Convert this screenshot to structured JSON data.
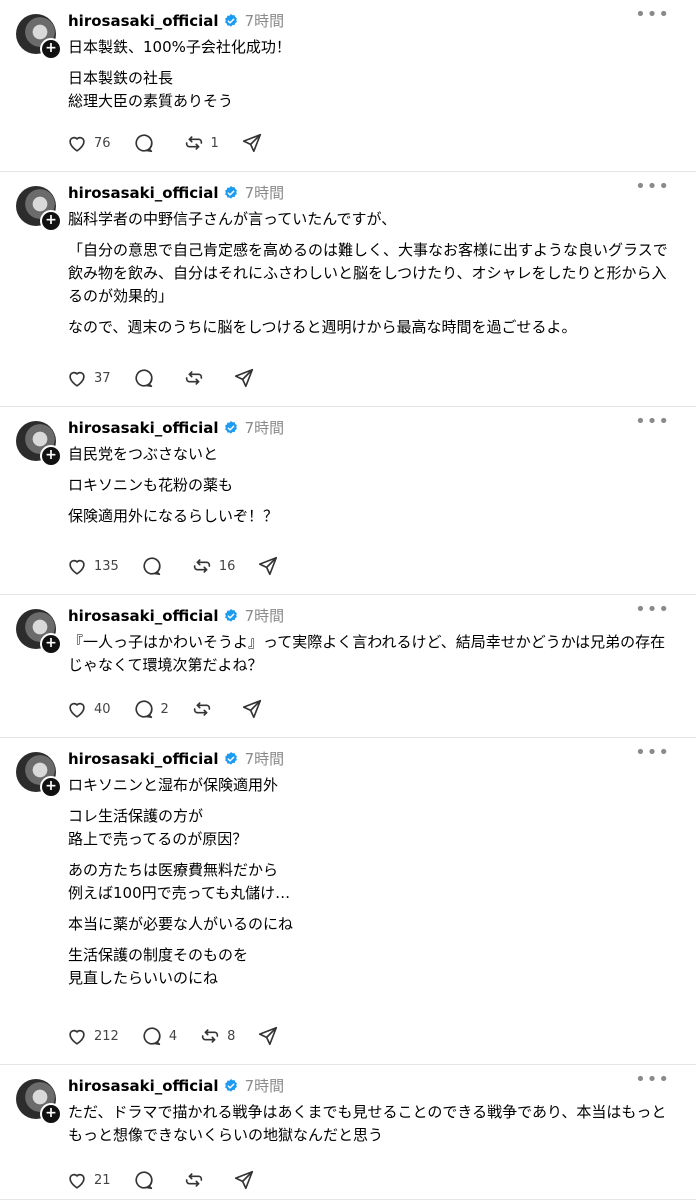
{
  "posts": [
    {
      "username": "hirosasaki_official",
      "time": "7時間",
      "paragraphs": [
        "日本製鉄、100%子会社化成功！",
        "日本製鉄の社長\n総理大臣の素質ありそう"
      ],
      "likes": "76",
      "replies": "",
      "reposts": "1"
    },
    {
      "username": "hirosasaki_official",
      "time": "7時間",
      "paragraphs": [
        "脳科学者の中野信子さんが言っていたんですが、",
        "「自分の意思で自己肯定感を高めるのは難しく、大事なお客様に出すような良いグラスで飲み物を飲み、自分はそれにふさわしいと脳をしつけたり、オシャレをしたりと形から入るのが効果的」",
        "なので、週末のうちに脳をしつけると週明けから最高な時間を過ごせるよ。"
      ],
      "likes": "37",
      "replies": "",
      "reposts": ""
    },
    {
      "username": "hirosasaki_official",
      "time": "7時間",
      "paragraphs": [
        "自民党をつぶさないと",
        "ロキソニンも花粉の薬も",
        "保険適用外になるらしいぞ！？"
      ],
      "likes": "135",
      "replies": "",
      "reposts": "16"
    },
    {
      "username": "hirosasaki_official",
      "time": "7時間",
      "paragraphs": [
        "『一人っ子はかわいそうよ』って実際よく言われるけど、結局幸せかどうかは兄弟の存在じゃなくて環境次第だよね？"
      ],
      "likes": "40",
      "replies": "2",
      "reposts": ""
    },
    {
      "username": "hirosasaki_official",
      "time": "7時間",
      "paragraphs": [
        "ロキソニンと湿布が保険適用外",
        "コレ生活保護の方が\n路上で売ってるのが原因？",
        "あの方たちは医療費無料だから\n例えば100円で売っても丸儲け…",
        "本当に薬が必要な人がいるのにね",
        "生活保護の制度そのものを\n見直したらいいのにね"
      ],
      "likes": "212",
      "replies": "4",
      "reposts": "8"
    },
    {
      "username": "hirosasaki_official",
      "time": "7時間",
      "paragraphs": [
        "ただ、ドラマで描かれる戦争はあくまでも見せることのできる戦争であり、本当はもっともっと想像できないくらいの地獄なんだと思う"
      ],
      "likes": "21",
      "replies": "",
      "reposts": ""
    }
  ],
  "icons": {
    "verified": "verified-badge-icon",
    "more": "more-icon",
    "like": "heart-icon",
    "reply": "comment-icon",
    "repost": "repost-icon",
    "share": "share-icon",
    "follow": "plus-icon"
  },
  "colors": {
    "verified": "#1d9bf0",
    "muted": "#8a8a8a",
    "divider": "#e5e5e5"
  }
}
